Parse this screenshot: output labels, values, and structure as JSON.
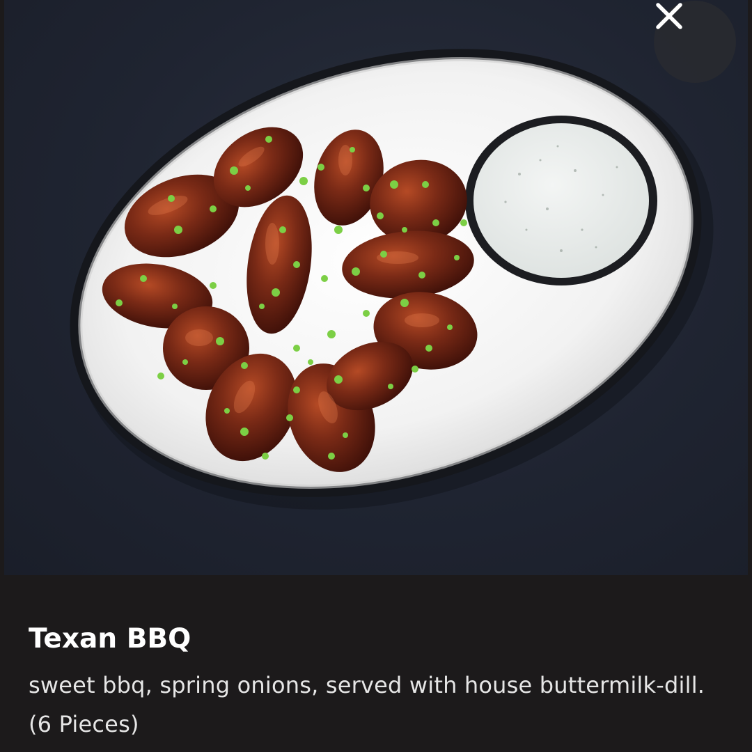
{
  "dialog": {
    "close_icon": "close-icon",
    "background_color": "#1c1a1b"
  },
  "photo": {
    "subject": "food-photo",
    "background_color": "#1f2431",
    "plate_color": "#f4f4f4",
    "sauce_color": "#5a1a12",
    "garnish_color": "#6cc23a"
  },
  "item": {
    "name": "Texan BBQ",
    "description": "sweet bbq, spring onions, served with house buttermilk-dill. (6 Pieces)"
  }
}
